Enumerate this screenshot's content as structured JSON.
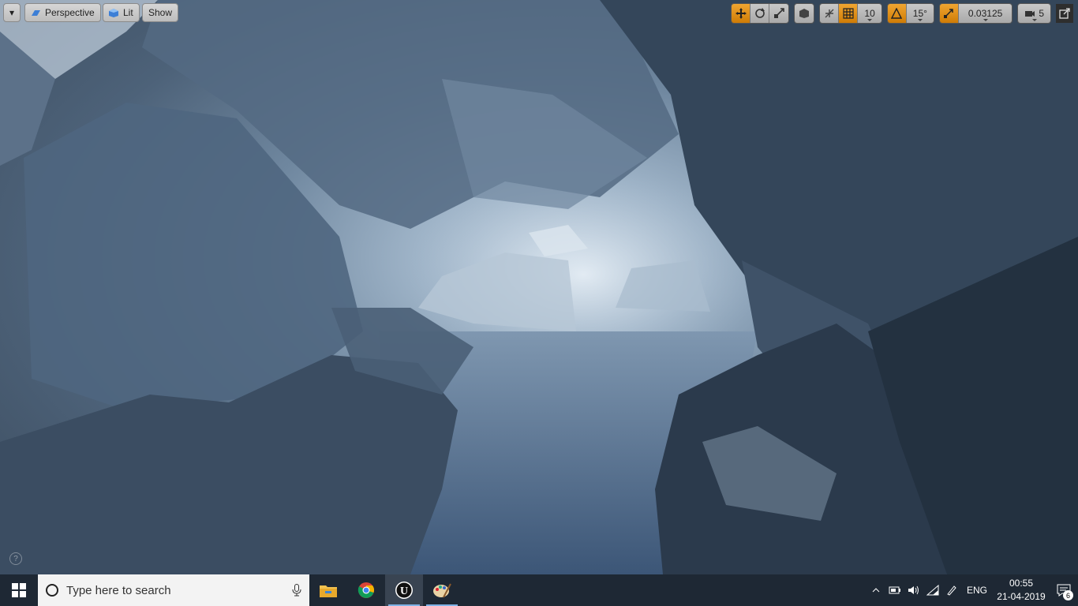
{
  "viewport": {
    "menu_button": "▾",
    "perspective_label": "Perspective",
    "lit_label": "Lit",
    "show_label": "Show",
    "help_icon": "?",
    "tools": {
      "grid_snap": "10",
      "rotation_snap": "15°",
      "scale_snap": "0.03125",
      "camera_speed": "5"
    }
  },
  "taskbar": {
    "search_placeholder": "Type here to search",
    "apps": [
      "file-explorer",
      "chrome",
      "unreal-engine",
      "paint"
    ],
    "language": "ENG",
    "time": "00:55",
    "date": "21-04-2019",
    "notification_count": "6"
  },
  "colors": {
    "accent_orange": "#e8950f",
    "taskbar": "#1e2834"
  }
}
